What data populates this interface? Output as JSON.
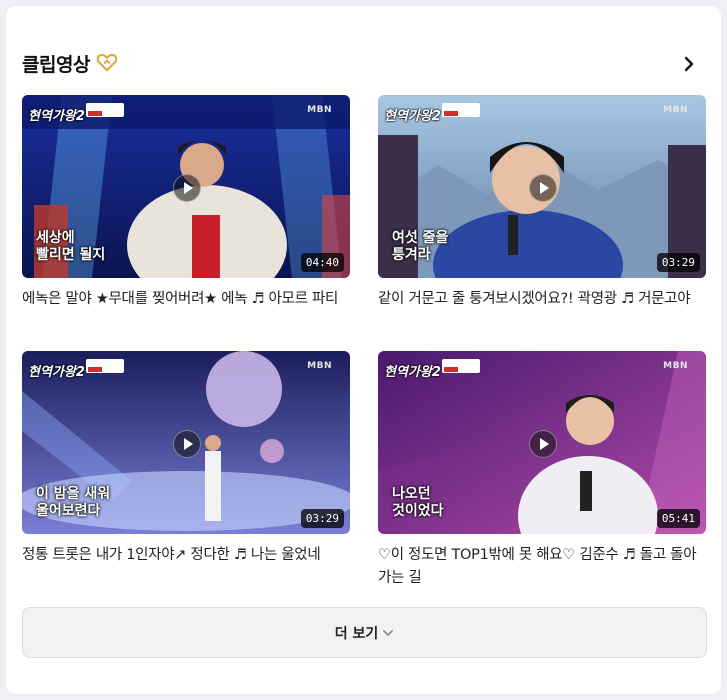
{
  "section": {
    "title": "클립영상",
    "heart_icon": "heart-icon",
    "more_icon": "chevron-right-icon"
  },
  "clips": [
    {
      "logo": "현역가왕2",
      "channel": "MBN",
      "caption": "세상에\n빨리면 될지",
      "duration": "04:40",
      "title": "에녹은 말야 ★무대를 찢어버려★ 에녹 ♬ 아모르 파티"
    },
    {
      "logo": "현역가왕2",
      "channel": "MBN",
      "caption": "여섯 줄을\n퉁겨라",
      "duration": "03:29",
      "title": "같이 거문고 줄 퉁겨보시겠어요?! 곽영광 ♬ 거문고야"
    },
    {
      "logo": "현역가왕2",
      "channel": "MBN",
      "caption": "이 밤을 새워\n울어보련다",
      "duration": "03:29",
      "title": "정통 트롯은 내가 1인자야↗ 정다한 ♬ 나는 울었네"
    },
    {
      "logo": "현역가왕2",
      "channel": "MBN",
      "caption": "나오던\n것이었다",
      "duration": "05:41",
      "title": "♡이 정도면 TOP1밖에 못 해요♡ 김준수 ♬ 돌고 돌아가는 길"
    }
  ],
  "more_button": {
    "label": "더 보기"
  },
  "colors": {
    "accent": "#e8a23a",
    "card_bg": "#ffffff",
    "page_bg": "#eef0f3"
  }
}
